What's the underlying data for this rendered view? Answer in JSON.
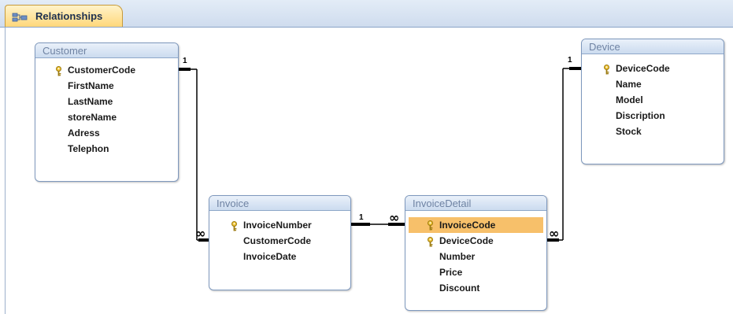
{
  "tab": {
    "label": "Relationships",
    "icon": "relationships-icon"
  },
  "tables": {
    "customer": {
      "title": "Customer",
      "fields": [
        "CustomerCode",
        "FirstName",
        "LastName",
        "storeName",
        "Adress",
        "Telephon"
      ]
    },
    "device": {
      "title": "Device",
      "fields": [
        "DeviceCode",
        "Name",
        "Model",
        "Discription",
        "Stock"
      ]
    },
    "invoice": {
      "title": "Invoice",
      "fields": [
        "InvoiceNumber",
        "CustomerCode",
        "InvoiceDate"
      ]
    },
    "invoicedetail": {
      "title": "InvoiceDetail",
      "fields": [
        "InvoiceCode",
        "DeviceCode",
        "Number",
        "Price",
        "Discount"
      ],
      "selected": "InvoiceCode"
    }
  },
  "relationships": {
    "one": "1",
    "many": "∞"
  },
  "colors": {
    "selection": "#f7c06a",
    "tab": "#ffd77a",
    "header": "#cbdbef",
    "key": "#d9a514"
  }
}
